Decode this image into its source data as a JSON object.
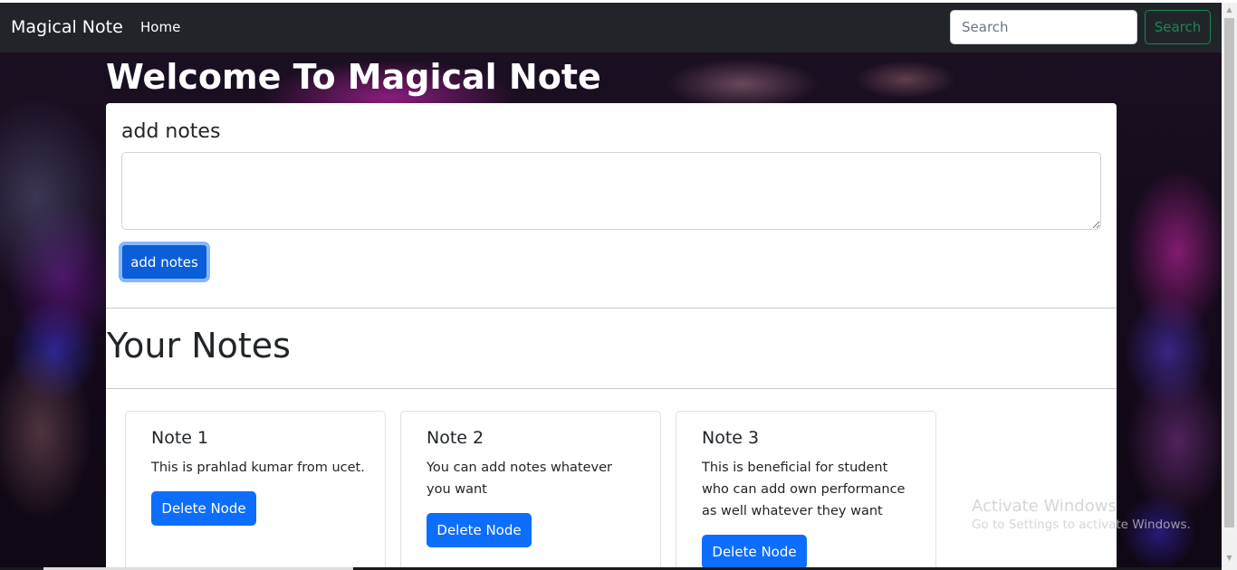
{
  "navbar": {
    "brand": "Magical Note",
    "home_label": "Home",
    "search_placeholder": "Search",
    "search_button_label": "Search"
  },
  "hero": {
    "title": "Welcome To Magical Note"
  },
  "add_section": {
    "heading": "add notes",
    "textarea_value": "",
    "button_label": "add notes"
  },
  "notes_section": {
    "heading": "Your Notes",
    "notes": [
      {
        "title": "Note 1",
        "text": "This is prahlad kumar from ucet.",
        "delete_label": "Delete Node"
      },
      {
        "title": "Note 2",
        "text": "You can add notes whatever you want",
        "delete_label": "Delete Node"
      },
      {
        "title": "Note 3",
        "text": "This is beneficial for student who can add own performance as well whatever they want",
        "delete_label": "Delete Node"
      }
    ]
  },
  "watermark": {
    "line1": "Activate Windows",
    "line2": "Go to Settings to activate Windows."
  },
  "colors": {
    "navbar_bg": "#212529",
    "primary": "#0d6efd",
    "success": "#198754"
  }
}
